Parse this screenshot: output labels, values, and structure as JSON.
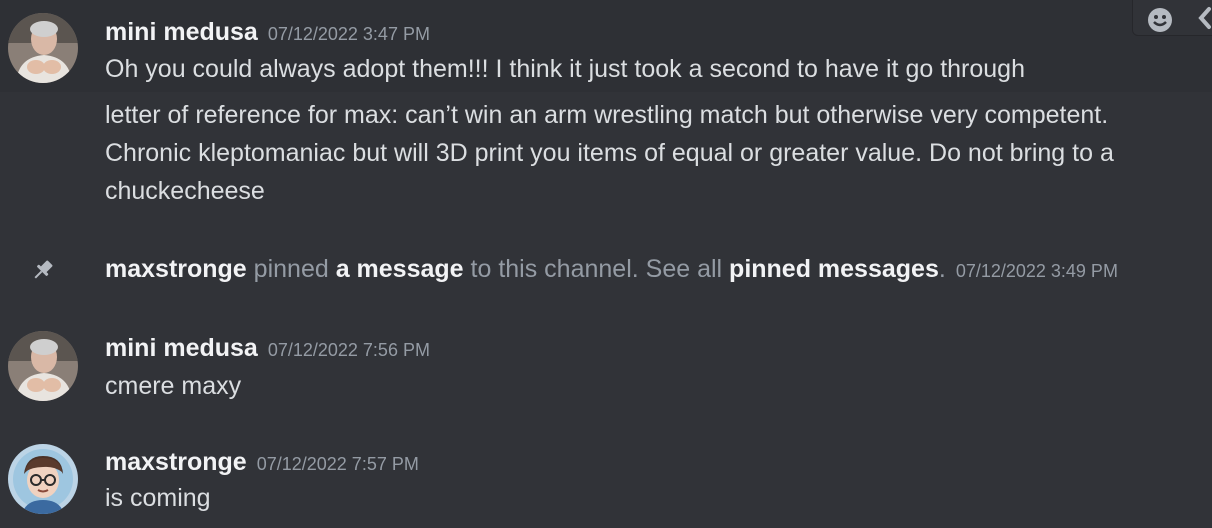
{
  "messages": [
    {
      "username": "mini medusa",
      "timestamp": "07/12/2022 3:47 PM",
      "avatar": "mini-medusa-avatar",
      "lines": [
        "Oh you could always adopt them!!! I think it just took a second to have it go through"
      ]
    },
    {
      "continuation": true,
      "lines": [
        "letter of reference for max: can’t win an arm wrestling match but otherwise very competent.",
        "Chronic kleptomaniac but will 3D print you items of equal or greater value. Do not bring to a",
        "chuckecheese"
      ]
    },
    {
      "username": "mini medusa",
      "timestamp": "07/12/2022 7:56 PM",
      "avatar": "mini-medusa-avatar",
      "lines": [
        "cmere maxy"
      ]
    },
    {
      "username": "maxstronge",
      "timestamp": "07/12/2022 7:57 PM",
      "avatar": "maxstronge-avatar",
      "lines": [
        "is coming"
      ]
    }
  ],
  "system": {
    "icon": "pin-icon",
    "actor": "maxstronge",
    "text_pinned": "pinned",
    "link_message": "a message",
    "text_to_channel": "to this channel. See all",
    "link_pinned": "pinned messages",
    "period": ".",
    "timestamp": "07/12/2022 3:49 PM"
  },
  "toolbar": {
    "icons": [
      "add-reaction-icon",
      "more-icon"
    ]
  },
  "colors": {
    "background": "#313338",
    "hover_background": "#2e3035",
    "username": "#f2f3f5",
    "text": "#dbdee1",
    "muted": "#949ba4"
  }
}
